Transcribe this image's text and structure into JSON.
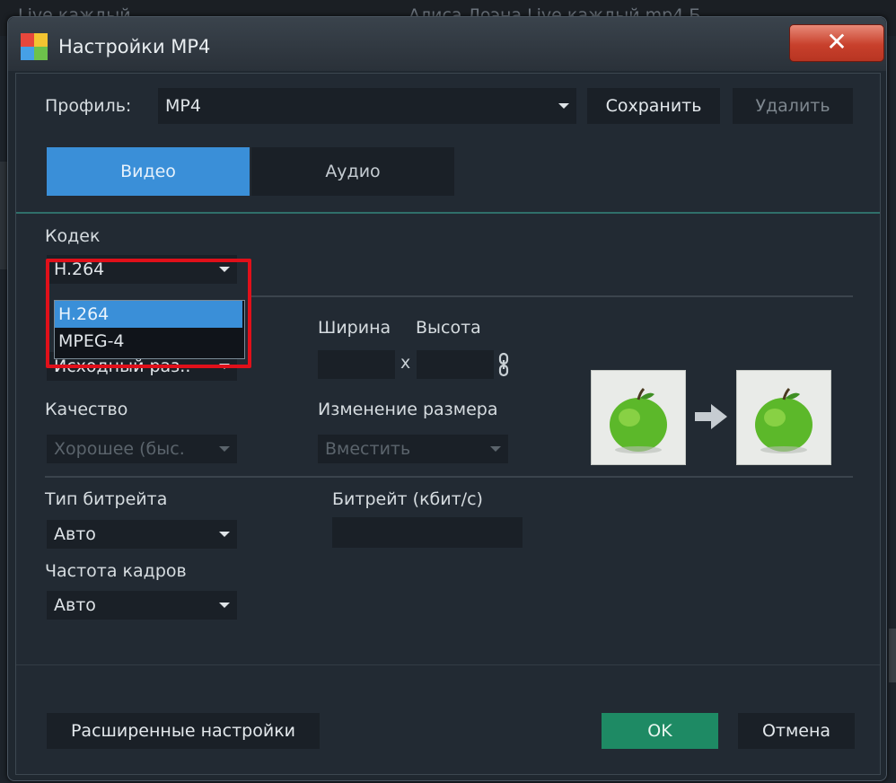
{
  "background": {
    "text_left": "Live каждый",
    "text_right": "Алиса  Лоэна  Live каждый mp4   Б"
  },
  "window": {
    "title": "Настройки MP4",
    "close_label": "✕"
  },
  "profile": {
    "label": "Профиль:",
    "value": "MP4",
    "save_label": "Сохранить",
    "delete_label": "Удалить"
  },
  "tabs": [
    {
      "label": "Видео",
      "active": true
    },
    {
      "label": "Аудио",
      "active": false
    }
  ],
  "codec": {
    "label": "Кодек",
    "value": "H.264",
    "options": [
      "H.264",
      "MPEG-4"
    ],
    "selected_option": "H.264"
  },
  "resolution": {
    "value": "Исходный раз..",
    "width_label": "Ширина",
    "height_label": "Высота",
    "x_label": "x"
  },
  "quality": {
    "label": "Качество",
    "value": "Хорошее (быс."
  },
  "resize": {
    "label": "Изменение размера",
    "value": "Вместить"
  },
  "bitrate_type": {
    "label": "Тип битрейта",
    "value": "Авто"
  },
  "bitrate": {
    "label": "Битрейт (кбит/с)",
    "value": ""
  },
  "framerate": {
    "label": "Частота кадров",
    "value": "Авто"
  },
  "footer": {
    "advanced_label": "Расширенные настройки",
    "ok_label": "OK",
    "cancel_label": "Отмена"
  },
  "colors": {
    "active_tab": "#3a8fd8",
    "ok_button": "#1e8a64",
    "highlight_box": "#e0101a",
    "close_button": "#c8402c"
  },
  "icons": [
    "app-icon",
    "close-icon",
    "chevron-down-icon",
    "chain-link-icon",
    "apple-icon",
    "arrow-right-icon"
  ]
}
